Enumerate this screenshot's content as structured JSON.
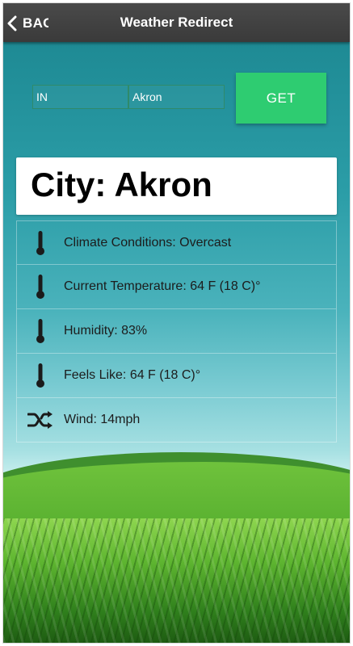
{
  "header": {
    "back_label": "BACK",
    "title": "Weather Redirect"
  },
  "form": {
    "state_value": "IN",
    "city_value": "Akron",
    "get_label": "GET"
  },
  "city_card": {
    "text": "City: Akron"
  },
  "conditions": [
    {
      "icon": "thermometer-icon",
      "text": "Climate Conditions: Overcast"
    },
    {
      "icon": "thermometer-icon",
      "text": "Current Temperature: 64 F (18 C)°"
    },
    {
      "icon": "thermometer-icon",
      "text": "Humidity: 83%"
    },
    {
      "icon": "thermometer-icon",
      "text": "Feels Like: 64 F (18 C)°"
    },
    {
      "icon": "shuffle-icon",
      "text": "Wind: 14mph"
    }
  ],
  "colors": {
    "header_bg": "#3f3f3f",
    "accent_green": "#2ecc71",
    "sky_teal": "#2b9da7"
  }
}
